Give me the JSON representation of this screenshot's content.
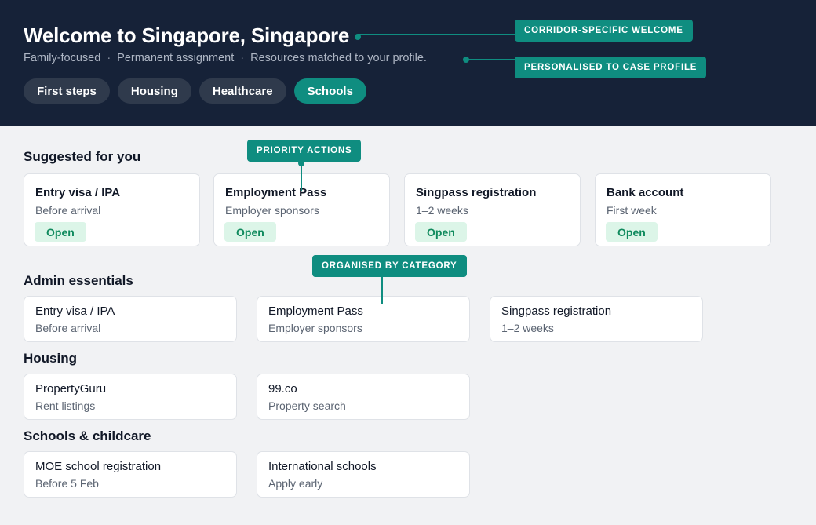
{
  "hero": {
    "title": "Welcome to Singapore, Singapore",
    "subtitle_parts": [
      "Family-focused",
      "Permanent assignment",
      "Resources matched to your profile."
    ],
    "separator": "·"
  },
  "tabs": [
    {
      "label": "First steps",
      "active": false
    },
    {
      "label": "Housing",
      "active": false
    },
    {
      "label": "Healthcare",
      "active": false
    },
    {
      "label": "Schools",
      "active": true
    }
  ],
  "suggested": {
    "title": "Suggested for you",
    "cards": [
      {
        "title": "Entry visa / IPA",
        "subtitle": "Before arrival",
        "action": "Open"
      },
      {
        "title": "Employment Pass",
        "subtitle": "Employer sponsors",
        "action": "Open"
      },
      {
        "title": "Singpass registration",
        "subtitle": "1–2 weeks",
        "action": "Open"
      },
      {
        "title": "Bank account",
        "subtitle": "First week",
        "action": "Open"
      }
    ]
  },
  "admin": {
    "title": "Admin essentials",
    "cards": [
      {
        "title": "Entry visa / IPA",
        "subtitle": "Before arrival"
      },
      {
        "title": "Employment Pass",
        "subtitle": "Employer sponsors"
      },
      {
        "title": "Singpass registration",
        "subtitle": "1–2 weeks"
      }
    ]
  },
  "housing": {
    "title": "Housing",
    "cards": [
      {
        "title": "PropertyGuru",
        "subtitle": "Rent listings"
      },
      {
        "title": "99.co",
        "subtitle": "Property search"
      }
    ]
  },
  "schools": {
    "title": "Schools & childcare",
    "cards": [
      {
        "title": "MOE school registration",
        "subtitle": "Before 5 Feb"
      },
      {
        "title": "International schools",
        "subtitle": "Apply early"
      }
    ]
  },
  "callouts": {
    "welcome": "CORRIDOR-SPECIFIC WELCOME",
    "profile": "PERSONALISED TO CASE PROFILE",
    "priority": "PRIORITY ACTIONS",
    "category": "ORGANISED BY CATEGORY"
  },
  "colors": {
    "hero_bg": "#162238",
    "accent": "#0f8d80",
    "tab_bg": "#2f3a4c",
    "open_bg": "#dcf5e8",
    "open_text": "#0f8a5d"
  }
}
